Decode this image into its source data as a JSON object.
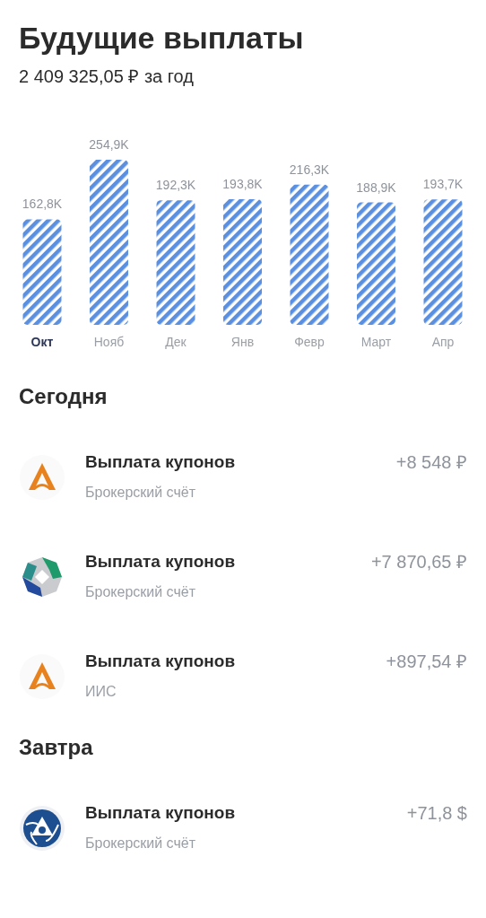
{
  "title": "Будущие выплаты",
  "total": "2 409 325,05 ₽ за год",
  "chart": {
    "chart_data": {
      "type": "bar",
      "categories": [
        "Окт",
        "Нояб",
        "Дек",
        "Янв",
        "Февр",
        "Март",
        "Апр"
      ],
      "values": [
        162.8,
        254.9,
        192.3,
        193.8,
        216.3,
        188.9,
        193.7
      ],
      "value_labels": [
        "162,8K",
        "254,9K",
        "192,3K",
        "193,8K",
        "216,3K",
        "188,9K",
        "193,7K"
      ]
    },
    "months": [
      {
        "selected": true
      },
      {
        "selected": false
      },
      {
        "selected": false
      },
      {
        "selected": false
      },
      {
        "selected": false
      },
      {
        "selected": false
      },
      {
        "selected": false
      }
    ]
  },
  "sections": [
    {
      "heading": "Сегодня",
      "payments": [
        {
          "kind": "arch",
          "title": "Выплата купонов",
          "account": "Брокерский счёт",
          "amount": "+8 548 ₽"
        },
        {
          "kind": "ring",
          "title": "Выплата купонов",
          "account": "Брокерский счёт",
          "amount": "+7 870,65 ₽"
        },
        {
          "kind": "arch",
          "title": "Выплата купонов",
          "account": "ИИС",
          "amount": "+897,54 ₽"
        }
      ]
    },
    {
      "heading": "Завтра",
      "payments": [
        {
          "kind": "atom",
          "title": "Выплата купонов",
          "account": "Брокерский счёт",
          "amount": "+71,8 $"
        }
      ]
    }
  ]
}
